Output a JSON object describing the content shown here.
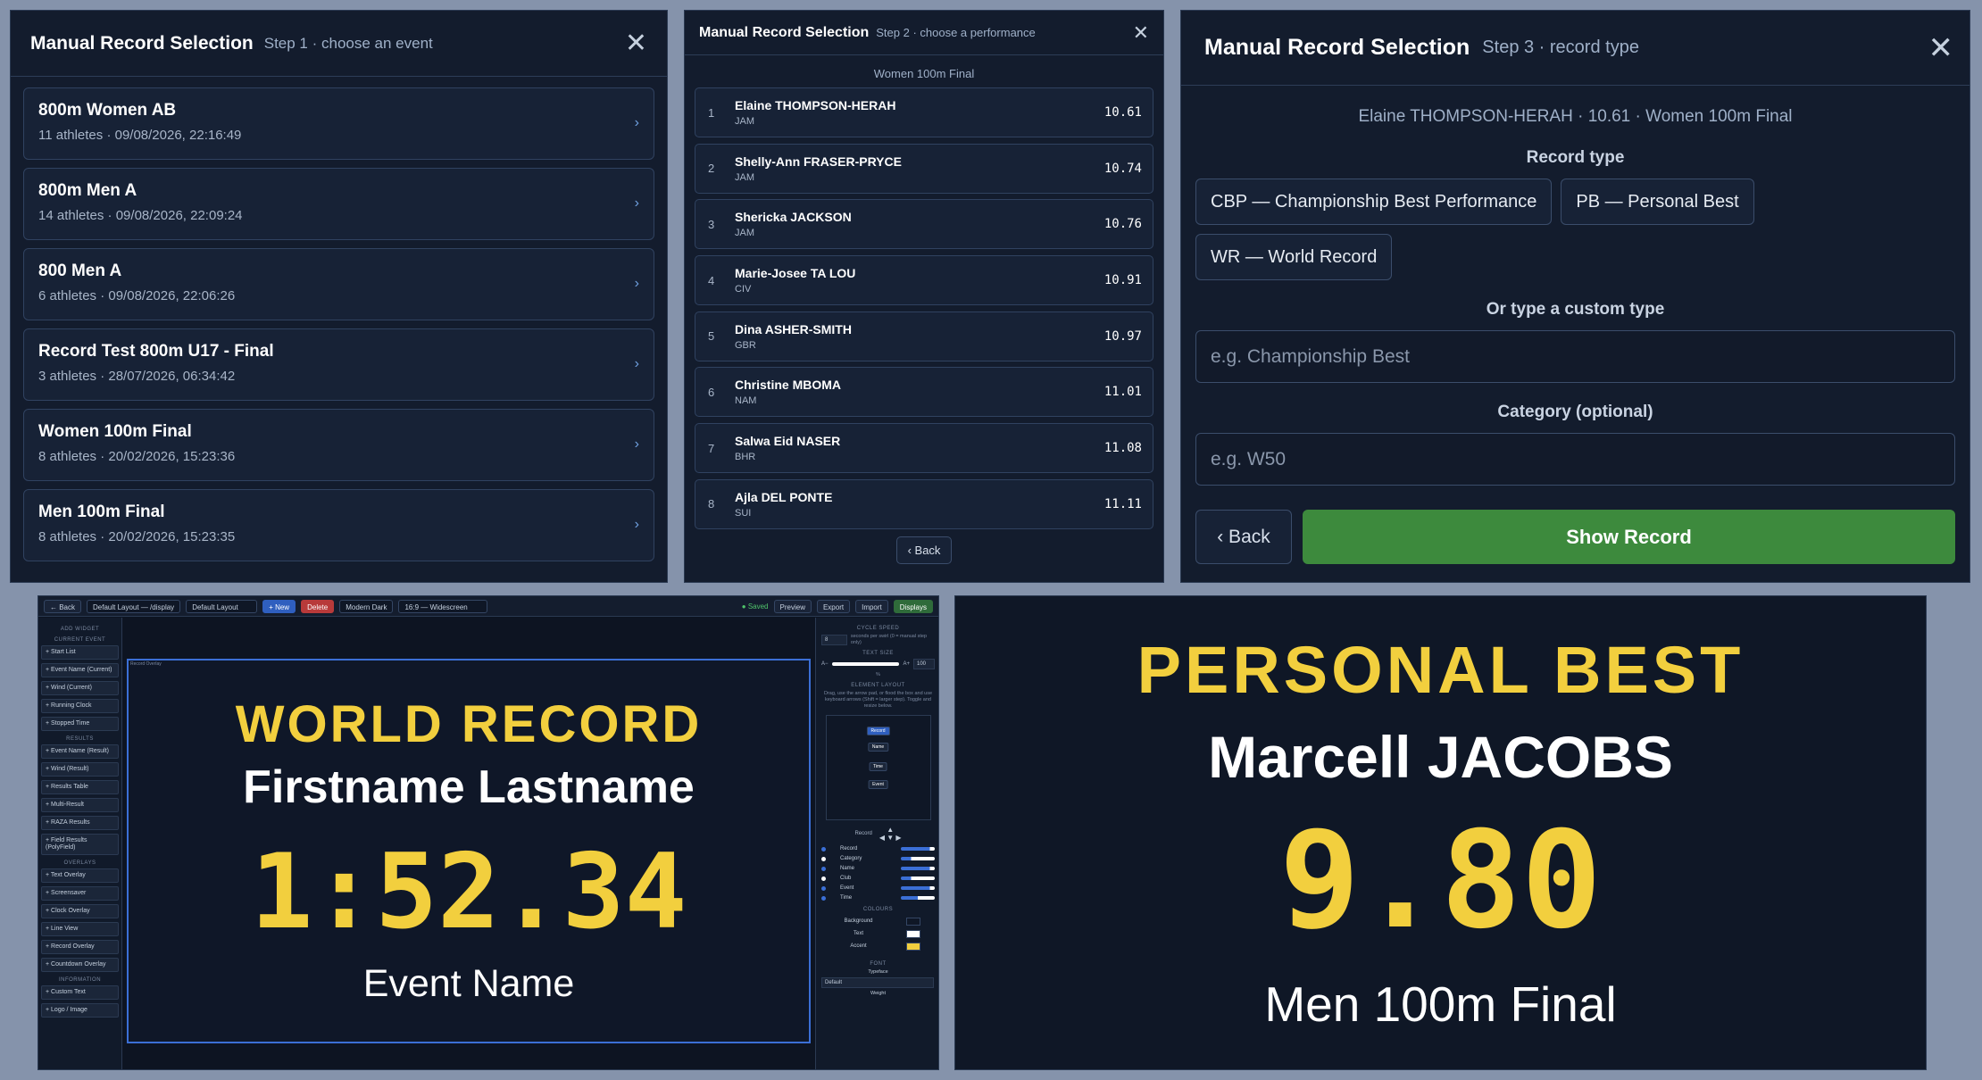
{
  "step1": {
    "title": "Manual Record Selection",
    "step": "Step 1 · choose an event",
    "close_glyph": "✕",
    "events": [
      {
        "name": "800m Women AB",
        "meta": "11 athletes · 09/08/2026, 22:16:49"
      },
      {
        "name": "800m Men A",
        "meta": "14 athletes · 09/08/2026, 22:09:24"
      },
      {
        "name": "800 Men A",
        "meta": "6 athletes · 09/08/2026, 22:06:26"
      },
      {
        "name": "Record Test 800m U17 - Final",
        "meta": "3 athletes · 28/07/2026, 06:34:42"
      },
      {
        "name": "Women 100m Final",
        "meta": "8 athletes · 20/02/2026, 15:23:36"
      },
      {
        "name": "Men 100m Final",
        "meta": "8 athletes · 20/02/2026, 15:23:35"
      }
    ],
    "chevron": "›"
  },
  "step2": {
    "title": "Manual Record Selection",
    "step": "Step 2 · choose a performance",
    "close_glyph": "✕",
    "event_caption": "Women 100m Final",
    "performances": [
      {
        "rank": "1",
        "name": "Elaine THOMPSON-HERAH",
        "nat": "JAM",
        "time": "10.61"
      },
      {
        "rank": "2",
        "name": "Shelly-Ann FRASER-PRYCE",
        "nat": "JAM",
        "time": "10.74"
      },
      {
        "rank": "3",
        "name": "Shericka JACKSON",
        "nat": "JAM",
        "time": "10.76"
      },
      {
        "rank": "4",
        "name": "Marie-Josee TA LOU",
        "nat": "CIV",
        "time": "10.91"
      },
      {
        "rank": "5",
        "name": "Dina ASHER-SMITH",
        "nat": "GBR",
        "time": "10.97"
      },
      {
        "rank": "6",
        "name": "Christine MBOMA",
        "nat": "NAM",
        "time": "11.01"
      },
      {
        "rank": "7",
        "name": "Salwa Eid NASER",
        "nat": "BHR",
        "time": "11.08"
      },
      {
        "rank": "8",
        "name": "Ajla DEL PONTE",
        "nat": "SUI",
        "time": "11.11"
      }
    ],
    "back_label": "‹ Back"
  },
  "step3": {
    "title": "Manual Record Selection",
    "step": "Step 3 · record type",
    "close_glyph": "✕",
    "summary": "Elaine THOMPSON-HERAH · 10.61 · Women 100m Final",
    "record_type_label": "Record type",
    "record_types": [
      "CBP — Championship Best Performance",
      "PB — Personal Best",
      "WR — World Record"
    ],
    "custom_label": "Or type a custom type",
    "custom_placeholder": "e.g. Championship Best",
    "category_label": "Category (optional)",
    "category_placeholder": "e.g. W50",
    "back_label": "‹ Back",
    "show_label": "Show Record"
  },
  "editor": {
    "toolbar": {
      "back": "← Back",
      "layout_select": "Default Layout — /display",
      "layout_name": "Default Layout",
      "new": "+ New",
      "delete": "Delete",
      "theme": "Modern Dark",
      "ratio": "16:9 — Widescreen",
      "saved": "● Saved",
      "preview": "Preview",
      "export": "Export",
      "import": "Import",
      "displays": "Displays"
    },
    "left": {
      "add_widget": "Add widget",
      "groups": [
        {
          "heading": "Current event",
          "items": [
            "+ Start List",
            "+ Event Name (Current)",
            "+ Wind (Current)",
            "+ Running Clock",
            "+ Stopped Time"
          ]
        },
        {
          "heading": "Results",
          "items": [
            "+ Event Name (Result)",
            "+ Wind (Result)",
            "+ Results Table",
            "+ Multi-Result",
            "+ RAZA Results",
            "+ Field Results (PolyField)"
          ]
        },
        {
          "heading": "Overlays",
          "items": [
            "+ Text Overlay",
            "+ Screensaver",
            "+ Clock Overlay",
            "+ Line View",
            "+ Record Overlay",
            "+ Countdown Overlay"
          ]
        },
        {
          "heading": "Information",
          "items": [
            "+ Custom Text",
            "+ Logo / Image"
          ]
        }
      ]
    },
    "canvas": {
      "tag": "Record Overlay",
      "record": "WORLD RECORD",
      "name": "Firstname Lastname",
      "time": "1:52.34",
      "event": "Event Name"
    },
    "right": {
      "cycle_heading": "Cycle speed",
      "cycle_value": "8",
      "cycle_note": "seconds per swirl (0 = manual step only)",
      "text_size_heading": "Text size",
      "text_minus": "A−",
      "text_plus": "A+",
      "text_value": "100",
      "text_unit": "%",
      "layout_heading": "Element layout",
      "layout_note": "Drag, use the arrow pad, or flood the box and use keyboard arrows (Shift = larger step). Toggle and resize below.",
      "layout_items": [
        "Record",
        "Name",
        "Time",
        "Event"
      ],
      "arrow_label": "Record",
      "toggles": [
        {
          "name": "Record",
          "on": true,
          "level": 0.85
        },
        {
          "name": "Category",
          "on": false,
          "level": 0.3
        },
        {
          "name": "Name",
          "on": true,
          "level": 0.85
        },
        {
          "name": "Club",
          "on": false,
          "level": 0.3
        },
        {
          "name": "Event",
          "on": true,
          "level": 0.85
        },
        {
          "name": "Time",
          "on": true,
          "level": 0.5
        }
      ],
      "colours_heading": "Colours",
      "colours": [
        {
          "name": "Background",
          "hex": "#0f1726"
        },
        {
          "name": "Text",
          "hex": "#ffffff"
        },
        {
          "name": "Accent",
          "hex": "#f2cf3e"
        }
      ],
      "font_heading": "Font",
      "typeface_label": "Typeface",
      "typeface_value": "Default",
      "weight_label": "Weight"
    }
  },
  "preview": {
    "record": "PERSONAL BEST",
    "name": "Marcell JACOBS",
    "time": "9.80",
    "event": "Men 100m Final"
  }
}
